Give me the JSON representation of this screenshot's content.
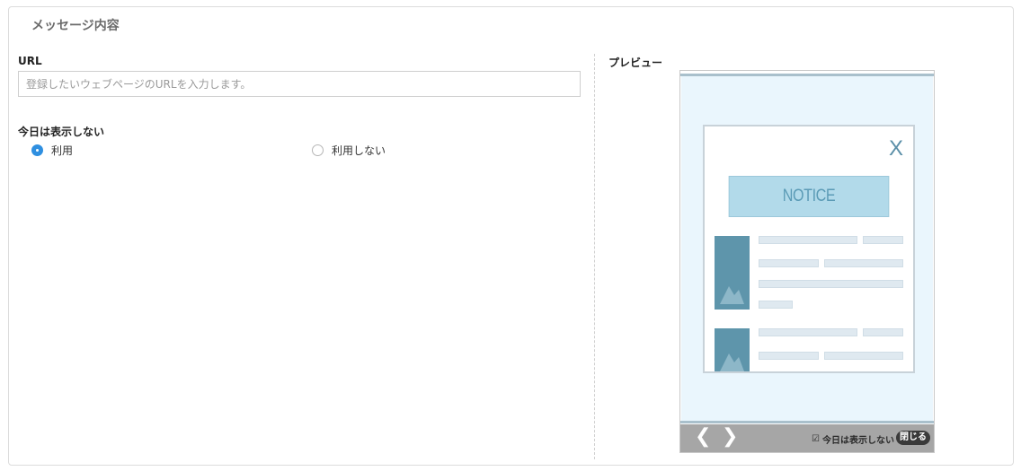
{
  "section_title": "メッセージ内容",
  "url_field": {
    "label": "URL",
    "value": "",
    "placeholder": "登録したいウェブページのURLを入力します。"
  },
  "hide_today": {
    "label": "今日は表示しない",
    "options": [
      {
        "label": "利用",
        "selected": true
      },
      {
        "label": "利用しない",
        "selected": false
      }
    ]
  },
  "preview": {
    "label": "プレビュー",
    "popup": {
      "close_glyph": "X",
      "notice_text": "NOTICE"
    },
    "footer": {
      "prev_glyph": "❮",
      "next_glyph": "❯",
      "checkbox_glyph": "☑",
      "hide_today_label": "今日は表示しない",
      "close_label": "閉じる"
    }
  },
  "colors": {
    "accent": "#2f8fe0",
    "notice_bg": "#b2daea",
    "thumb": "#5e95ab",
    "footer_bg": "#a6a6a6"
  }
}
